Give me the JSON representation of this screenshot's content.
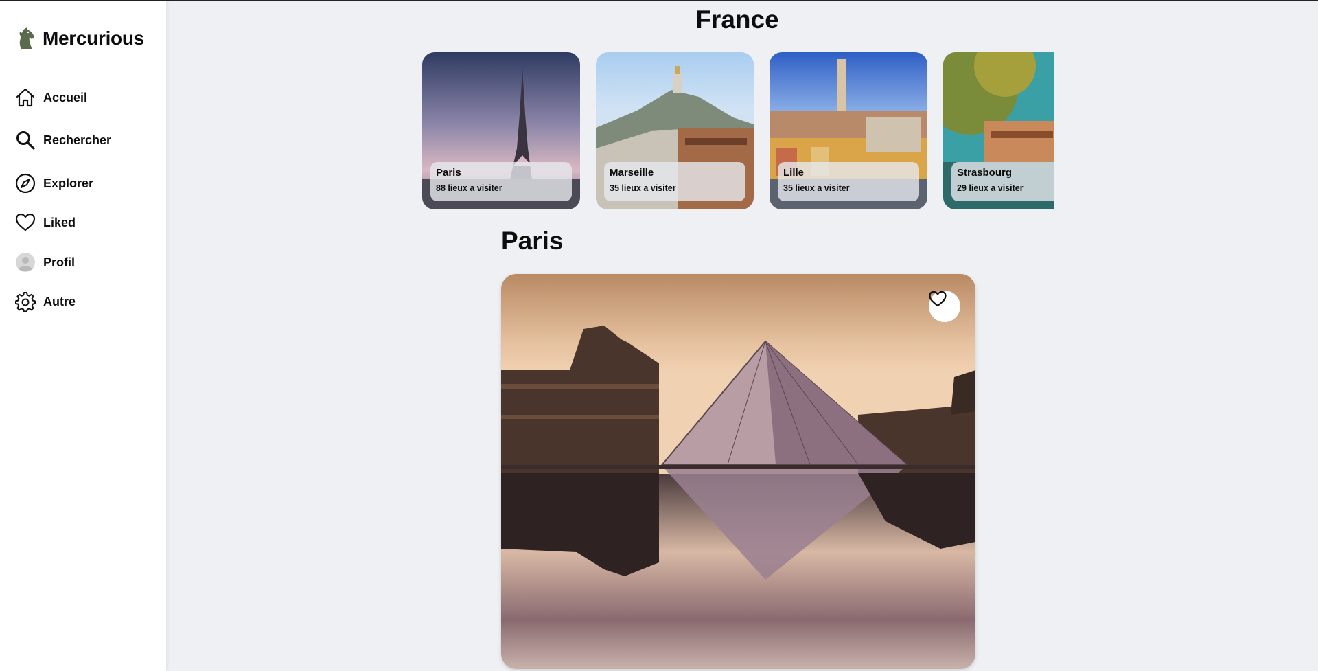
{
  "app": {
    "name": "Mercurious"
  },
  "sidebar": {
    "items": [
      {
        "label": "Accueil",
        "icon": "home-icon"
      },
      {
        "label": "Rechercher",
        "icon": "search-icon"
      },
      {
        "label": "Explorer",
        "icon": "compass-icon"
      },
      {
        "label": "Liked",
        "icon": "heart-icon"
      },
      {
        "label": "Profil",
        "icon": "avatar-icon"
      },
      {
        "label": "Autre",
        "icon": "gear-icon"
      }
    ]
  },
  "country": {
    "title": "France"
  },
  "cities": [
    {
      "name": "Paris",
      "places": "88 lieux a visiter"
    },
    {
      "name": "Marseille",
      "places": "35 lieux a visiter"
    },
    {
      "name": "Lille",
      "places": "35 lieux a visiter"
    },
    {
      "name": "Strasbourg",
      "places": "29 lieux a visiter"
    }
  ],
  "section": {
    "title": "Paris"
  },
  "colors": {
    "accent": "#5a6b4c",
    "background": "#eef0f4",
    "sidebar": "#ffffff"
  }
}
